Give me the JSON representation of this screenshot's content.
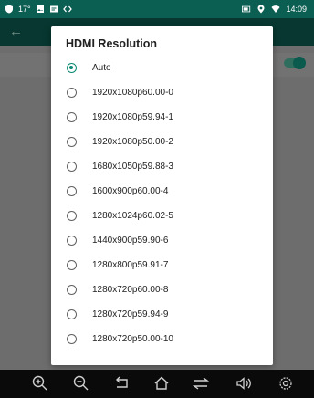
{
  "status_bar": {
    "temperature": "17°",
    "time": "14:09",
    "icons": [
      "shield-icon",
      "image-icon",
      "message-icon",
      "code-icon",
      "battery-icon",
      "location-icon",
      "wifi-icon"
    ]
  },
  "dialog": {
    "title": "HDMI Resolution",
    "options": [
      {
        "label": "Auto",
        "selected": true
      },
      {
        "label": "1920x1080p60.00-0",
        "selected": false
      },
      {
        "label": "1920x1080p59.94-1",
        "selected": false
      },
      {
        "label": "1920x1080p50.00-2",
        "selected": false
      },
      {
        "label": "1680x1050p59.88-3",
        "selected": false
      },
      {
        "label": "1600x900p60.00-4",
        "selected": false
      },
      {
        "label": "1280x1024p60.02-5",
        "selected": false
      },
      {
        "label": "1440x900p59.90-6",
        "selected": false
      },
      {
        "label": "1280x800p59.91-7",
        "selected": false
      },
      {
        "label": "1280x720p60.00-8",
        "selected": false
      },
      {
        "label": "1280x720p59.94-9",
        "selected": false
      },
      {
        "label": "1280x720p50.00-10",
        "selected": false
      }
    ]
  },
  "navbar": {
    "buttons": [
      "zoom-in-icon",
      "zoom-out-icon",
      "back-icon",
      "home-icon",
      "recents-icon",
      "volume-icon",
      "settings-icon"
    ]
  },
  "colors": {
    "accent": "#0b8a73",
    "status_bar": "#0b5e52",
    "navbar": "#0a0a0a"
  }
}
